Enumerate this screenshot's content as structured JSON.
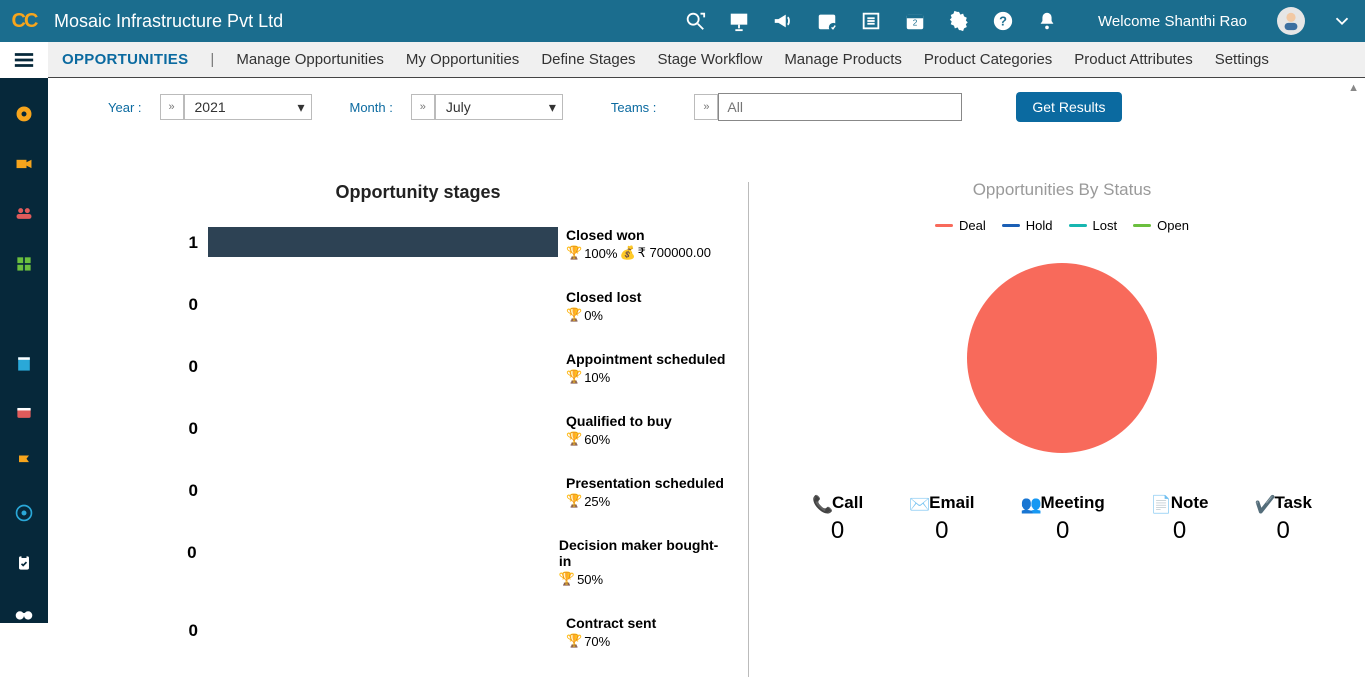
{
  "header": {
    "company": "Mosaic Infrastructure Pvt Ltd",
    "welcome": "Welcome Shanthi Rao"
  },
  "subnav": {
    "primary": "OPPORTUNITIES",
    "items": [
      "Manage Opportunities",
      "My Opportunities",
      "Define Stages",
      "Stage Workflow",
      "Manage Products",
      "Product Categories",
      "Product Attributes",
      "Settings"
    ]
  },
  "filters": {
    "year_label": "Year :",
    "year_value": "2021",
    "month_label": "Month :",
    "month_value": "July",
    "teams_label": "Teams :",
    "teams_placeholder": "All",
    "button": "Get Results"
  },
  "chart_data": {
    "stages": {
      "type": "bar",
      "title": "Opportunity stages",
      "items": [
        {
          "count": "1",
          "name": "Closed won",
          "percent": "100%",
          "amount": "₹ 700000.00",
          "fill": 100
        },
        {
          "count": "0",
          "name": "Closed lost",
          "percent": "0%",
          "amount": "",
          "fill": 0
        },
        {
          "count": "0",
          "name": "Appointment scheduled",
          "percent": "10%",
          "amount": "",
          "fill": 0
        },
        {
          "count": "0",
          "name": "Qualified to buy",
          "percent": "60%",
          "amount": "",
          "fill": 0
        },
        {
          "count": "0",
          "name": "Presentation scheduled",
          "percent": "25%",
          "amount": "",
          "fill": 0
        },
        {
          "count": "0",
          "name": "Decision maker bought-in",
          "percent": "50%",
          "amount": "",
          "fill": 0
        },
        {
          "count": "0",
          "name": "Contract sent",
          "percent": "70%",
          "amount": "",
          "fill": 0
        }
      ]
    },
    "status": {
      "type": "pie",
      "title": "Opportunities By Status",
      "series": [
        {
          "name": "Deal",
          "value": 1,
          "color": "#f86a5b"
        },
        {
          "name": "Hold",
          "value": 0,
          "color": "#1b5fb5"
        },
        {
          "name": "Lost",
          "value": 0,
          "color": "#17b6b0"
        },
        {
          "name": "Open",
          "value": 0,
          "color": "#6bbf3e"
        }
      ]
    }
  },
  "activities": [
    {
      "label": "Call",
      "count": "0"
    },
    {
      "label": "Email",
      "count": "0"
    },
    {
      "label": "Meeting",
      "count": "0"
    },
    {
      "label": "Note",
      "count": "0"
    },
    {
      "label": "Task",
      "count": "0"
    }
  ]
}
